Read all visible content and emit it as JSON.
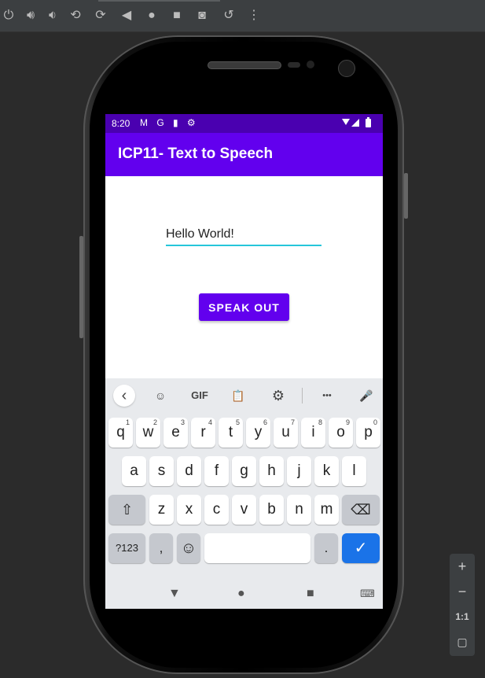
{
  "emulator": {
    "toolbar_icons": [
      "power-icon",
      "volume-up-icon",
      "volume-down-icon",
      "rotate-left-icon",
      "rotate-right-icon",
      "back-icon",
      "home-icon",
      "overview-icon",
      "camera-icon",
      "replay-icon",
      "more-icon"
    ],
    "zoom": {
      "plus": "+",
      "minus": "−",
      "ratio": "1:1"
    }
  },
  "statusbar": {
    "time": "8:20",
    "icons": "M G ▮ ⚙"
  },
  "app": {
    "title": "ICP11- Text to Speech",
    "input_value": "Hello World!",
    "button_label": "SPEAK OUT",
    "colors": {
      "primary": "#6200ee",
      "primary_dark": "#4a00b0",
      "accent": "#26c6da"
    }
  },
  "keyboard": {
    "tools": {
      "back": "‹",
      "sticker": "☺",
      "gif": "GIF",
      "clipboard": "📋",
      "settings": "⚙",
      "more": "•••",
      "mic": "🎤"
    },
    "row1": [
      {
        "k": "q",
        "s": "1"
      },
      {
        "k": "w",
        "s": "2"
      },
      {
        "k": "e",
        "s": "3"
      },
      {
        "k": "r",
        "s": "4"
      },
      {
        "k": "t",
        "s": "5"
      },
      {
        "k": "y",
        "s": "6"
      },
      {
        "k": "u",
        "s": "7"
      },
      {
        "k": "i",
        "s": "8"
      },
      {
        "k": "o",
        "s": "9"
      },
      {
        "k": "p",
        "s": "0"
      }
    ],
    "row2": [
      "a",
      "s",
      "d",
      "f",
      "g",
      "h",
      "j",
      "k",
      "l"
    ],
    "row3": [
      "z",
      "x",
      "c",
      "v",
      "b",
      "n",
      "m"
    ],
    "shift": "⇧",
    "backspace": "⌫",
    "symbols": "?123",
    "comma": ",",
    "emoji": "☺",
    "period": ".",
    "enter": "✓"
  },
  "navbar": {
    "back": "▼",
    "home": "●",
    "recents": "■",
    "keyboard": "⌨"
  }
}
